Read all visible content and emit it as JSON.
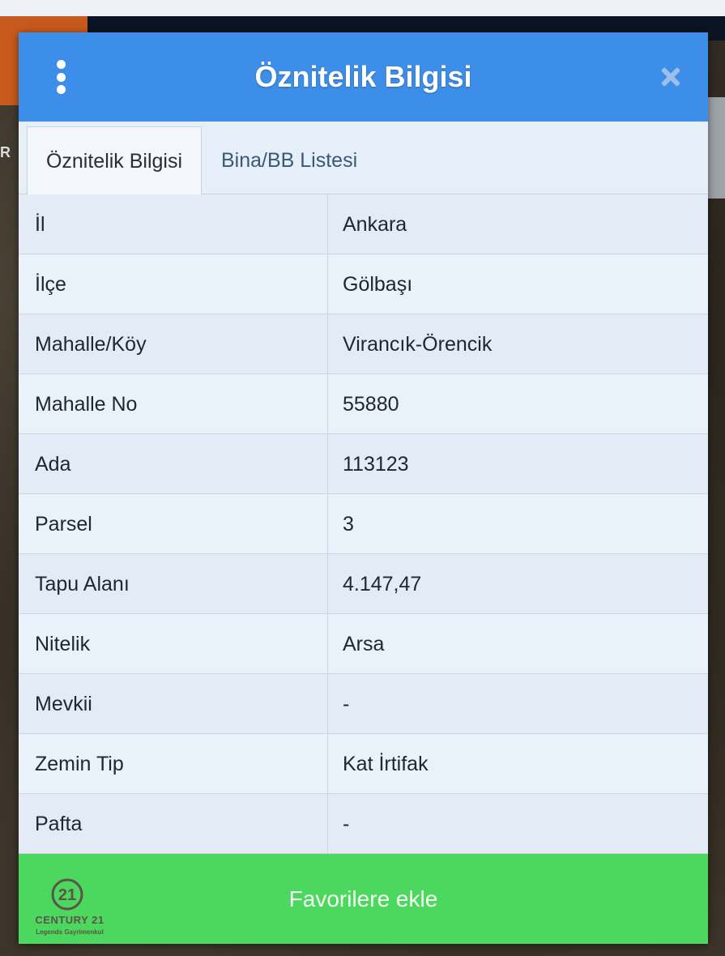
{
  "dialog": {
    "title": "Öznitelik Bilgisi"
  },
  "tabs": [
    {
      "label": "Öznitelik Bilgisi",
      "active": true
    },
    {
      "label": "Bina/BB Listesi",
      "active": false
    }
  ],
  "edge_label": "R",
  "attributes": [
    {
      "key": "İl",
      "value": "Ankara"
    },
    {
      "key": "İlçe",
      "value": "Gölbaşı"
    },
    {
      "key": "Mahalle/Köy",
      "value": "Virancık-Örencik"
    },
    {
      "key": "Mahalle No",
      "value": "55880"
    },
    {
      "key": "Ada",
      "value": "113123"
    },
    {
      "key": "Parsel",
      "value": "3"
    },
    {
      "key": "Tapu Alanı",
      "value": "4.147,47"
    },
    {
      "key": "Nitelik",
      "value": "Arsa"
    },
    {
      "key": "Mevkii",
      "value": "-"
    },
    {
      "key": "Zemin Tip",
      "value": "Kat İrtifak"
    },
    {
      "key": "Pafta",
      "value": "-"
    }
  ],
  "footer": {
    "button_label": "Favorilere ekle",
    "logo_name": "CENTURY 21",
    "logo_sub": "Legends Gayrimenkul"
  },
  "colors": {
    "header": "#3d8ee8",
    "button": "#4cd75e",
    "accent_orange": "#c85a1e"
  },
  "icons": {
    "menu": "vertical-dots-icon",
    "close": "close-icon"
  }
}
